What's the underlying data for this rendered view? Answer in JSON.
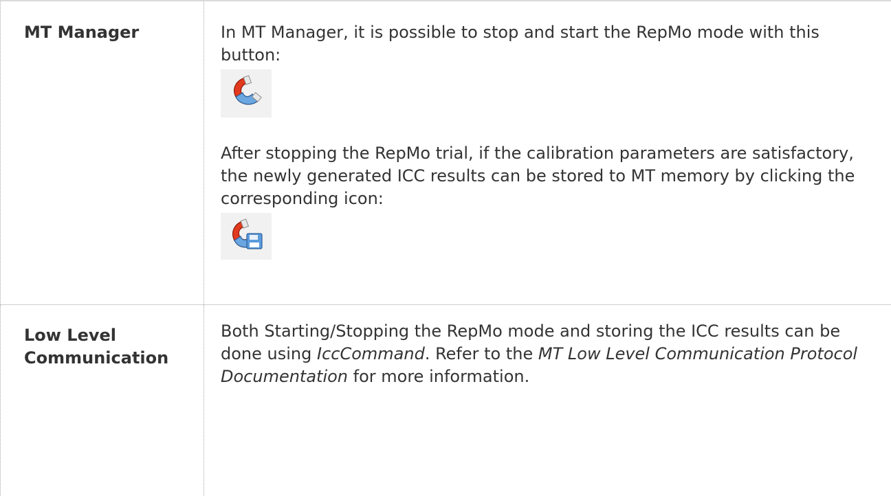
{
  "rows": [
    {
      "label": "MT Manager",
      "para1": "In MT Manager, it is possible to stop and start the RepMo mode with this button:",
      "icon1": "magnet-icon",
      "para2": "After stopping the RepMo trial, if the calibration parameters are satisfactory, the newly generated ICC results can be stored to MT memory by clicking the corresponding icon:",
      "icon2": "magnet-save-icon"
    },
    {
      "label": "Low Level Communication",
      "text_part1": "Both Starting/Stopping the RepMo mode and storing the ICC results can be done using ",
      "command": "IccCommand",
      "text_part2": ". Refer to the ",
      "doc_title": "MT Low Level Communication Protocol Documentation",
      "text_part3": " for more information."
    }
  ],
  "colors": {
    "text": "#333333",
    "border": "#dadada",
    "icon_bg": "#f1f1f1",
    "magnet_red": "#e23a1e",
    "magnet_blue": "#6aa6e0"
  }
}
